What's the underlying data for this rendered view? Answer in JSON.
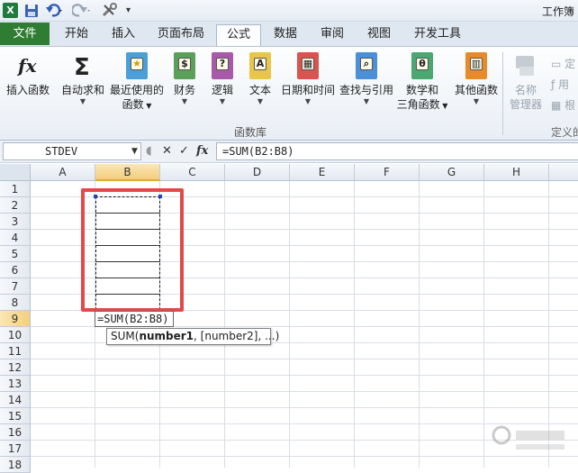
{
  "window": {
    "title": "工作簿"
  },
  "quick_access": {
    "logo": "X"
  },
  "tabs": [
    {
      "id": "file",
      "label": "文件"
    },
    {
      "id": "home",
      "label": "开始"
    },
    {
      "id": "insert",
      "label": "插入"
    },
    {
      "id": "layout",
      "label": "页面布局"
    },
    {
      "id": "formula",
      "label": "公式",
      "active": true
    },
    {
      "id": "data",
      "label": "数据"
    },
    {
      "id": "review",
      "label": "审阅"
    },
    {
      "id": "view",
      "label": "视图"
    },
    {
      "id": "developer",
      "label": "开发工具"
    }
  ],
  "ribbon": {
    "insert_function": {
      "line1": "插入函数"
    },
    "autosum": {
      "line1": "自动求和"
    },
    "recent": {
      "line1": "最近使用的",
      "line2": "函数"
    },
    "financial": {
      "line1": "财务"
    },
    "logical": {
      "line1": "逻辑"
    },
    "text": {
      "line1": "文本"
    },
    "datetime": {
      "line1": "日期和时间"
    },
    "lookup": {
      "line1": "查找与引用"
    },
    "math": {
      "line1": "数学和",
      "line2": "三角函数"
    },
    "other": {
      "line1": "其他函数"
    },
    "name_manager": {
      "line1": "名称",
      "line2": "管理器"
    },
    "define_1": "定",
    "define_2": "用",
    "define_3": "根",
    "group_label": "函数库",
    "group_label2": "定义的"
  },
  "formula_bar": {
    "name_box": "STDEV",
    "formula": "=SUM(B2:B8)"
  },
  "grid": {
    "columns": [
      "A",
      "B",
      "C",
      "D",
      "E",
      "F",
      "G",
      "H"
    ],
    "selected_column": "B",
    "rows": [
      "1",
      "2",
      "3",
      "4",
      "5",
      "6",
      "7",
      "8",
      "9",
      "10",
      "11",
      "12",
      "13",
      "14",
      "15",
      "16",
      "17",
      "18"
    ],
    "selected_row": "9",
    "edit_cell_text": "=SUM(B2:B8)"
  },
  "tooltip": {
    "func": "SUM(",
    "arg1": "number1",
    "rest": ", [number2], ...)"
  },
  "colors": {
    "file_tab": "#2e7d32",
    "highlight_box": "#e24a4a",
    "selected_header": "#f3cf7e"
  }
}
